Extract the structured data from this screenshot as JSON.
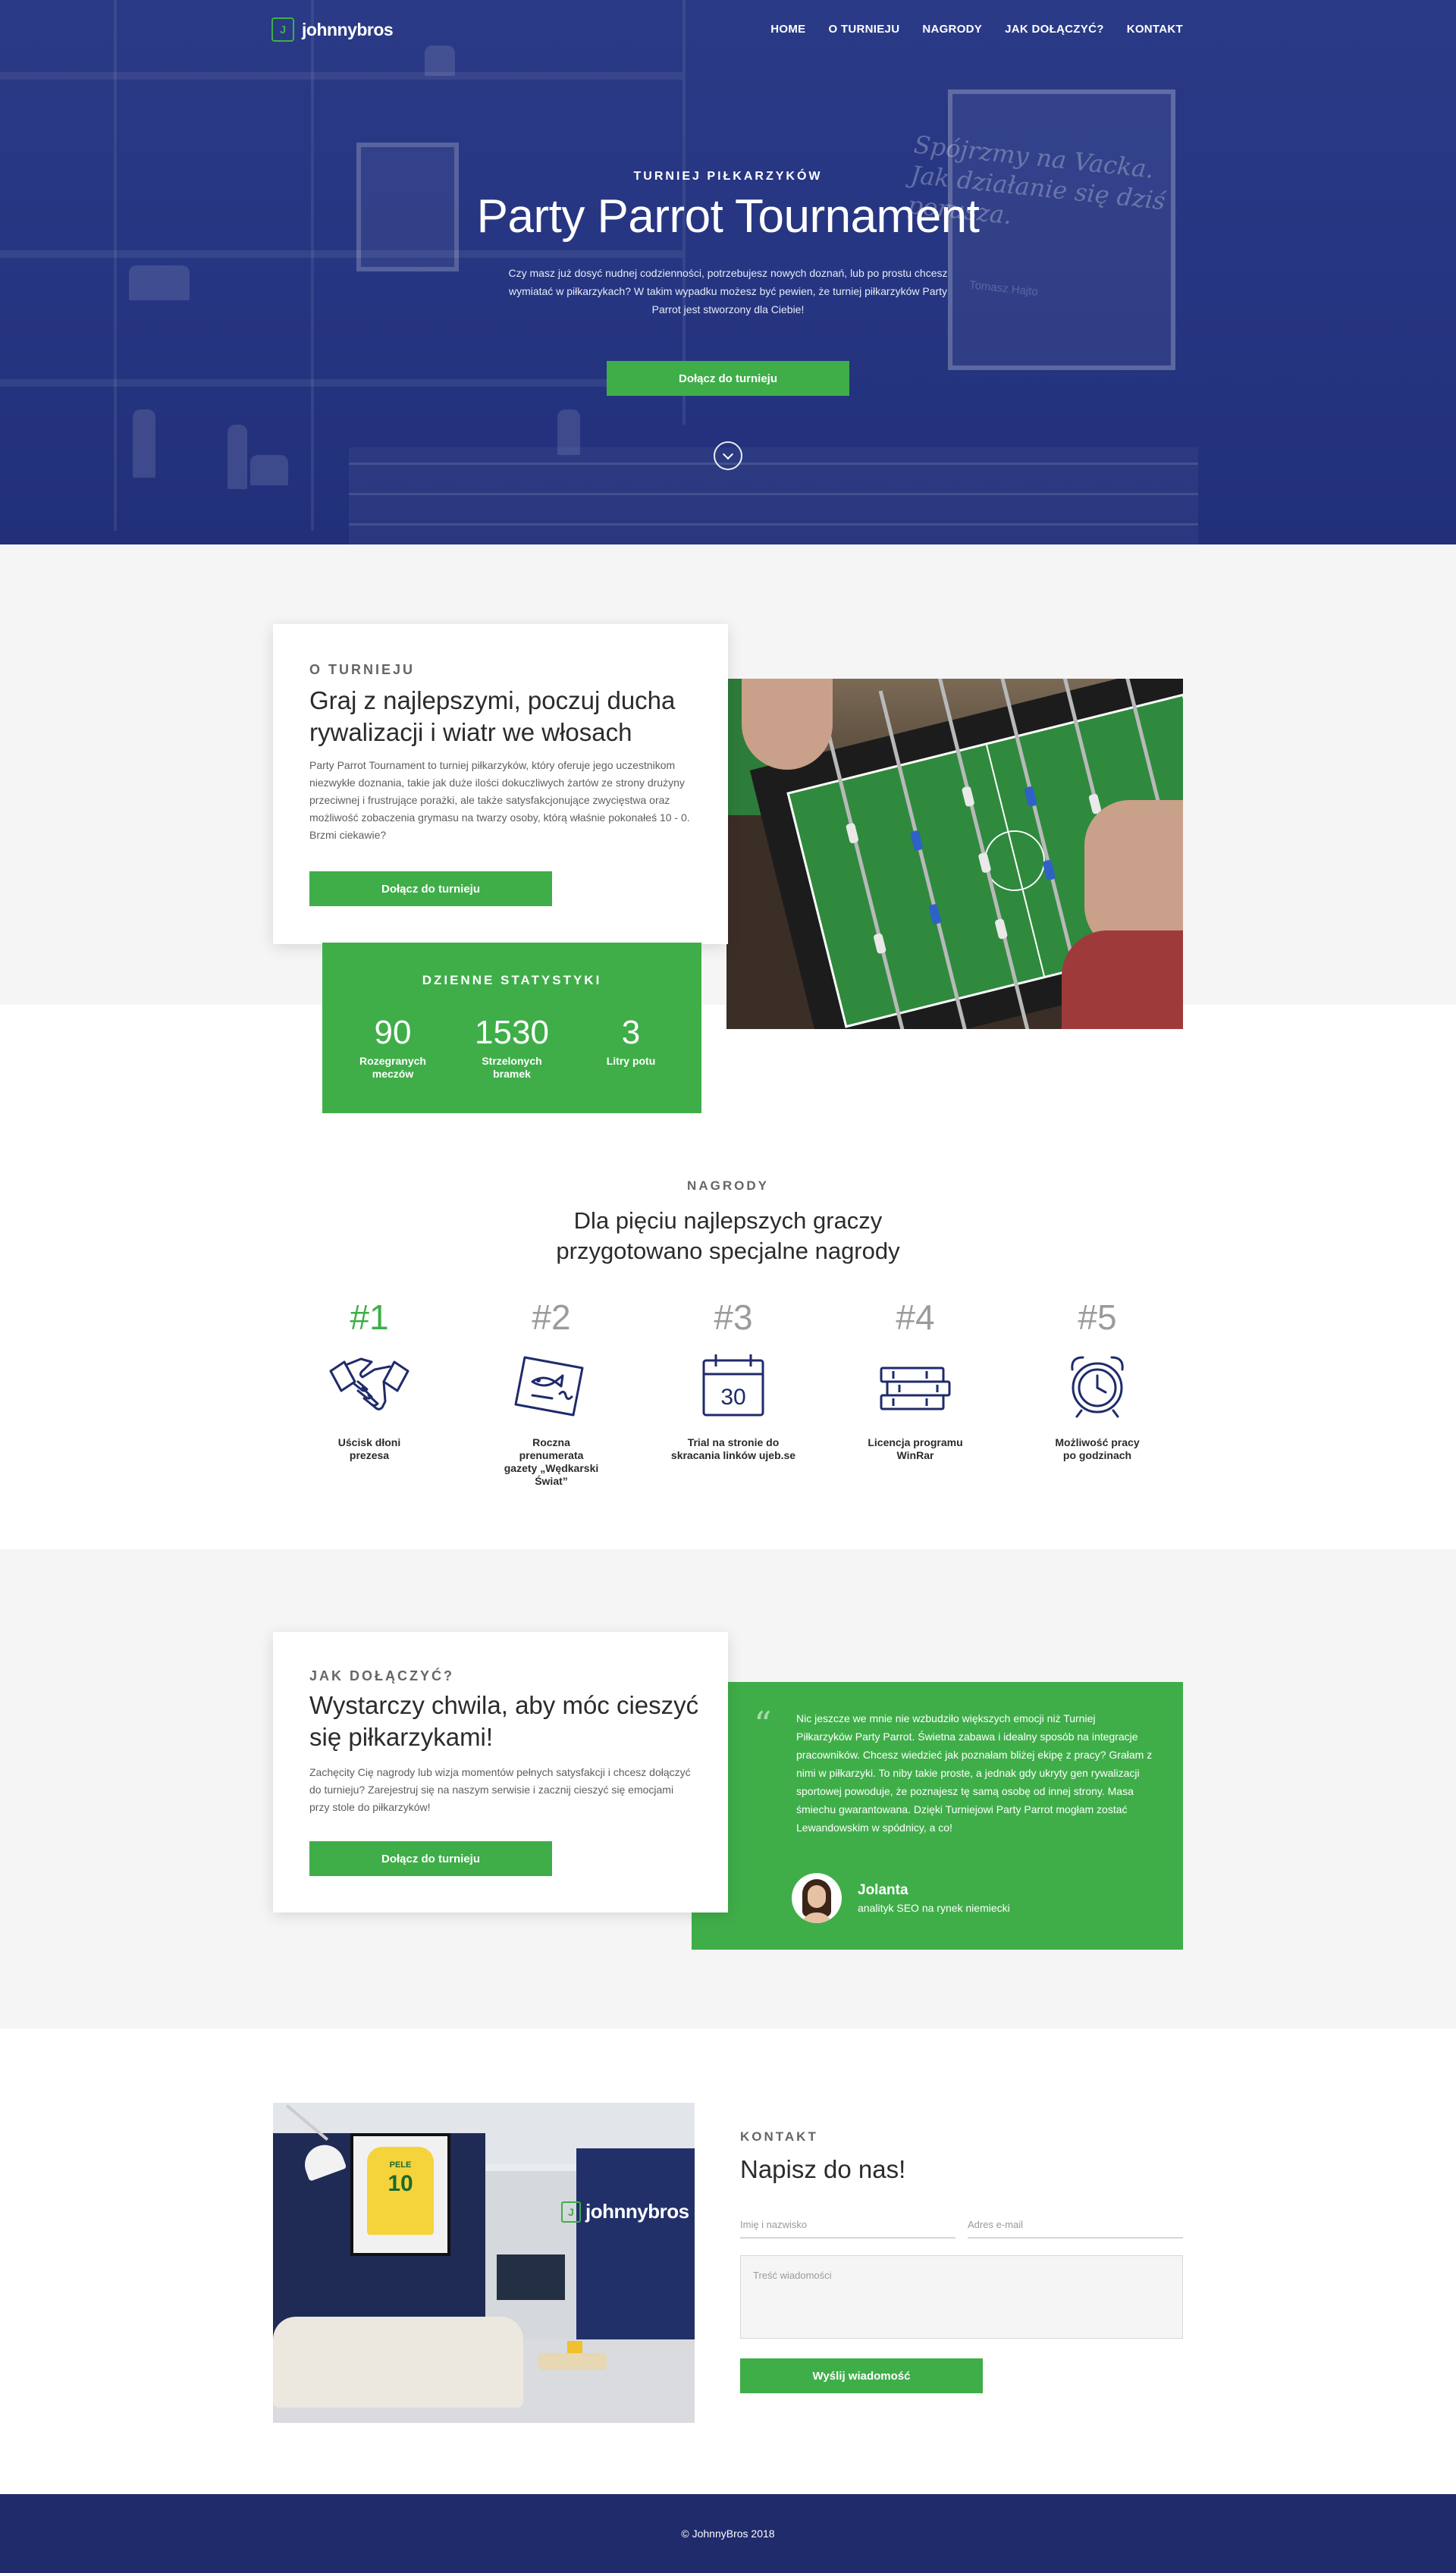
{
  "brand": {
    "name": "johnnybros",
    "mark": "J"
  },
  "nav": {
    "items": [
      "HOME",
      "O TURNIEJU",
      "NAGRODY",
      "JAK DOŁĄCZYĆ?",
      "KONTAKT"
    ]
  },
  "hero": {
    "kicker": "TURNIEJ PIŁKARZYKÓW",
    "title": "Party Parrot Tournament",
    "text": "Czy masz już dosyć nudnej codzienności, potrzebujesz nowych doznań, lub po prostu chcesz wymiatać w piłkarzykach? W takim wypadku możesz być pewien, że turniej piłkarzyków Party Parrot jest stworzony dla Ciebie!",
    "cta": "Dołącz do turnieju",
    "bg_quote": [
      "Spójrzmy na Vacka.",
      "Jak działanie się dziś",
      "porusza."
    ],
    "bg_signature": "Tomasz Hajto"
  },
  "about": {
    "kicker": "O TURNIEJU",
    "title": "Graj z najlepszymi, poczuj ducha rywalizacji i wiatr we włosach",
    "text": "Party Parrot Tournament to turniej piłkarzyków, który oferuje jego uczestnikom niezwykłe doznania, takie jak duże ilości dokuczliwych żartów ze strony drużyny przeciwnej i frustrujące porażki, ale także satysfakcjonujące zwycięstwa oraz możliwość zobaczenia grymasu na twarzy osoby, którą właśnie pokonałeś 10 - 0. Brzmi ciekawie?",
    "cta": "Dołącz do turnieju"
  },
  "stats": {
    "title": "DZIENNE STATYSTYKI",
    "items": [
      {
        "value": "90",
        "label": "Rozegranych meczów"
      },
      {
        "value": "1530",
        "label": "Strzelonych bramek"
      },
      {
        "value": "3",
        "label": "Litry potu"
      }
    ]
  },
  "prizes": {
    "kicker": "NAGRODY",
    "title": "Dla pięciu najlepszych graczy przygotowano specjalne nagrody",
    "items": [
      {
        "rank": "#1",
        "label": "Uścisk dłoni prezesa",
        "icon": "handshake-icon"
      },
      {
        "rank": "#2",
        "label": "Roczna prenumerata gazety „Wędkarski Świat”",
        "icon": "magazine-icon"
      },
      {
        "rank": "#3",
        "label": "Trial na stronie do skracania linków ujeb.se",
        "icon": "calendar-icon",
        "icon_text": "30"
      },
      {
        "rank": "#4",
        "label": "Licencja programu WinRar",
        "icon": "books-icon"
      },
      {
        "rank": "#5",
        "label": "Możliwość pracy po godzinach",
        "icon": "alarm-clock-icon"
      }
    ],
    "accent_rank_color": "#3fae49",
    "rank_color": "#9b9b9b"
  },
  "join": {
    "kicker": "JAK DOŁĄCZYĆ?",
    "title": "Wystarczy chwila, aby móc cieszyć się piłkarzykami!",
    "text": "Zachęcity Cię nagrody lub wizja momentów pełnych satysfakcji i chcesz dołączyć do turnieju? Zarejestruj się na naszym serwisie i zacznij cieszyć się emocjami przy stole do piłkarzyków!",
    "cta": "Dołącz do turnieju"
  },
  "testimonial": {
    "quote": "Nic jeszcze we mnie nie wzbudziło większych emocji niż Turniej Piłkarzyków Party Parrot. Świetna zabawa i idealny sposób na integracje pracowników. Chcesz wiedzieć jak poznałam bliżej ekipę z pracy? Grałam z nimi w piłkarzyki. To niby takie proste, a jednak gdy ukryty gen rywalizacji sportowej powoduje, że poznajesz tę samą osobę od innej strony. Masa śmiechu gwarantowana. Dzięki Turniejowi Party Parrot mogłam zostać Lewandowskim w spódnicy, a co!",
    "name": "Jolanta",
    "role": "analityk SEO na rynek niemiecki"
  },
  "office": {
    "jersey_name": "PELE",
    "jersey_number": "10",
    "wall_logo": "johnnybros"
  },
  "contact": {
    "kicker": "KONTAKT",
    "title": "Napisz do nas!",
    "name_placeholder": "Imię i nazwisko",
    "email_placeholder": "Adres e-mail",
    "message_placeholder": "Treść wiadomości",
    "submit": "Wyślij wiadomość"
  },
  "footer": {
    "text": "© JohnnyBros 2018"
  },
  "colors": {
    "brand_green": "#3fae49",
    "navy": "#263581",
    "footer_navy": "#1f2b6b",
    "icon_navy": "#1f2b6b"
  }
}
